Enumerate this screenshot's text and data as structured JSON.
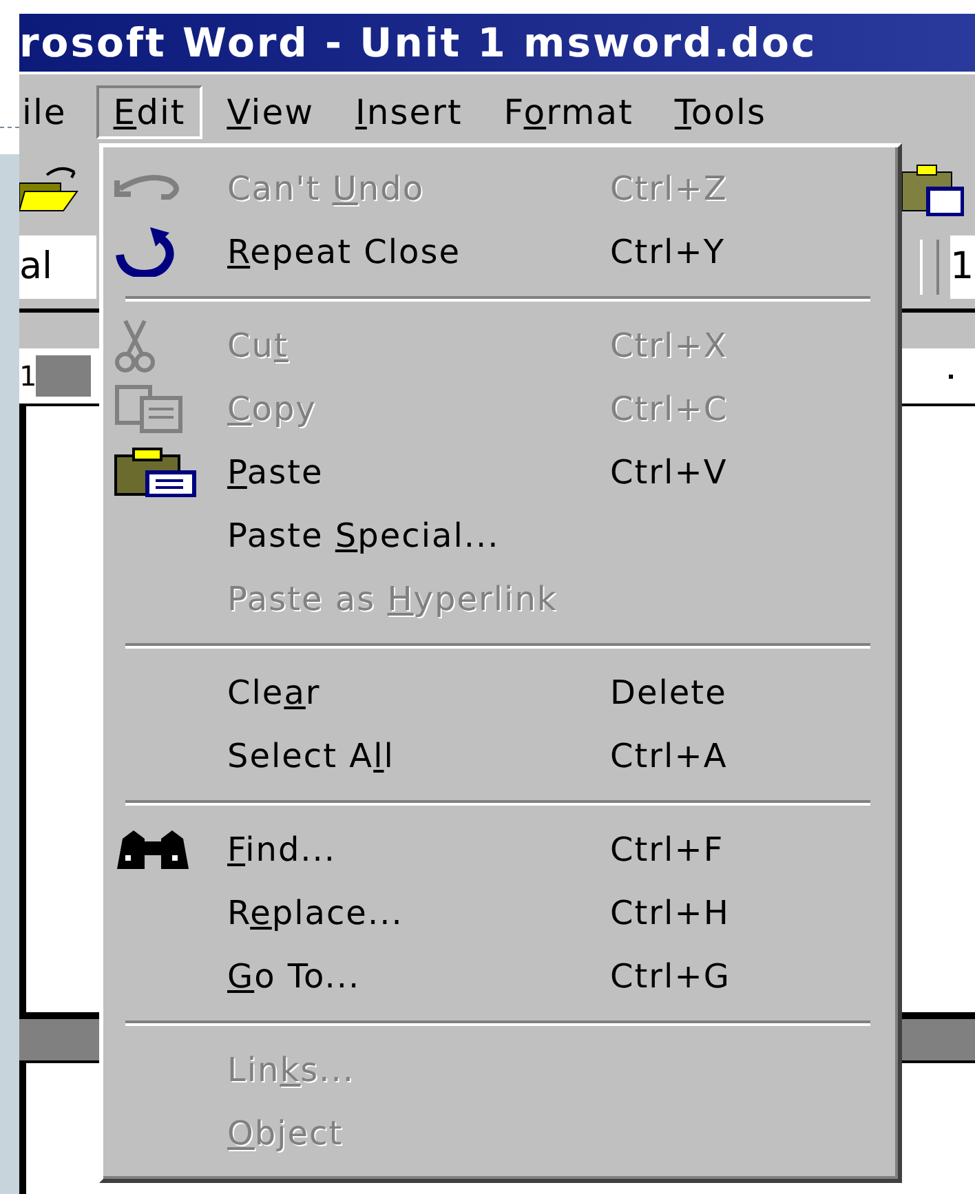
{
  "window": {
    "title": "rosoft Word - Unit 1 msword.doc"
  },
  "menu_bar": [
    {
      "pre": "ile",
      "selected": false
    },
    {
      "key": "E",
      "post": "dit",
      "selected": true
    },
    {
      "key": "V",
      "post": "iew",
      "selected": false
    },
    {
      "key": "I",
      "post": "nsert",
      "selected": false
    },
    {
      "pre": "F",
      "key": "o",
      "post": "rmat",
      "selected": false
    },
    {
      "key": "T",
      "post": "ools",
      "selected": false
    }
  ],
  "toolbar": {
    "font_name": "al",
    "font_size": "1"
  },
  "ruler": {
    "mark": "1"
  },
  "edit_menu": {
    "items": [
      {
        "kind": "item",
        "pre": "Can't ",
        "key": "U",
        "post": "ndo",
        "shortcut": "Ctrl+Z",
        "disabled": true
      },
      {
        "kind": "item",
        "key": "R",
        "post": "epeat Close",
        "shortcut": "Ctrl+Y",
        "disabled": false
      },
      {
        "kind": "separator"
      },
      {
        "kind": "item",
        "pre": "Cu",
        "key": "t",
        "shortcut": "Ctrl+X",
        "disabled": true
      },
      {
        "kind": "item",
        "key": "C",
        "post": "opy",
        "shortcut": "Ctrl+C",
        "disabled": true
      },
      {
        "kind": "item",
        "key": "P",
        "post": "aste",
        "shortcut": "Ctrl+V",
        "disabled": false
      },
      {
        "kind": "item",
        "pre": "Paste ",
        "key": "S",
        "post": "pecial...",
        "disabled": false
      },
      {
        "kind": "item",
        "pre": "Paste as ",
        "key": "H",
        "post": "yperlink",
        "disabled": true
      },
      {
        "kind": "separator"
      },
      {
        "kind": "item",
        "pre": "Cle",
        "key": "a",
        "post": "r",
        "shortcut": "Delete",
        "disabled": false
      },
      {
        "kind": "item",
        "pre": "Select A",
        "key": "l",
        "post": "l",
        "shortcut": "Ctrl+A",
        "disabled": false
      },
      {
        "kind": "separator"
      },
      {
        "kind": "item",
        "key": "F",
        "post": "ind...",
        "shortcut": "Ctrl+F",
        "disabled": false
      },
      {
        "kind": "item",
        "pre": "R",
        "key": "e",
        "post": "place...",
        "shortcut": "Ctrl+H",
        "disabled": false
      },
      {
        "kind": "item",
        "key": "G",
        "post": "o To...",
        "shortcut": "Ctrl+G",
        "disabled": false
      },
      {
        "kind": "separator"
      },
      {
        "kind": "item",
        "pre": "Lin",
        "key": "k",
        "post": "s...",
        "disabled": true
      },
      {
        "kind": "item",
        "key": "O",
        "post": "bject",
        "disabled": true
      }
    ]
  }
}
